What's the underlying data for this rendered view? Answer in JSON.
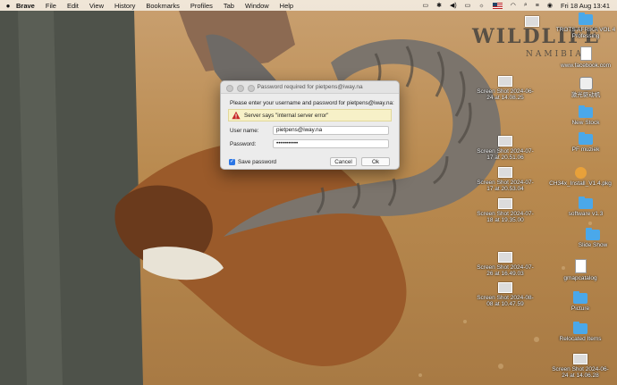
{
  "menubar": {
    "apple_icon": "apple-logo-icon",
    "items": [
      "Brave",
      "File",
      "Edit",
      "View",
      "History",
      "Bookmarks",
      "Profiles",
      "Tab",
      "Window",
      "Help"
    ],
    "clock": "Fri 18 Aug  13:41"
  },
  "wallpaper": {
    "brand_top": "WILDLIFE",
    "brand_bottom": "NAMIBIA"
  },
  "dialog": {
    "title": "Password required for pietpens@iway.na",
    "prompt": "Please enter your username and password for pietpens@iway.na:",
    "warning": "Server says \"internal server error\"",
    "username_label": "User name:",
    "username_value": "pietpens@iway.na",
    "password_label": "Password:",
    "password_value": "•••••••••••",
    "save_label": "Save password",
    "save_checked": true,
    "cancel_label": "Cancel",
    "ok_label": "Ok"
  },
  "desktop_icons": [
    {
      "label": "Screen Shot 2024-06-24 at 14.08.25",
      "kind": "screenshot"
    },
    {
      "label": "New Stock",
      "kind": "folder"
    },
    {
      "label": "Screen Shot 2024-07-17 at 20.51.06",
      "kind": "screenshot"
    },
    {
      "label": "PF muziek",
      "kind": "folder"
    },
    {
      "label": "Screen Shot 2024-07-17 at 20.53.04",
      "kind": "screenshot"
    },
    {
      "label": "CH34x_Install_V1.4.pkg",
      "kind": "package"
    },
    {
      "label": "Screen Shot 2024-07-18 at 19.35.00",
      "kind": "screenshot"
    },
    {
      "label": "software v1.3",
      "kind": "folder"
    },
    {
      "label": "Slide Show",
      "kind": "folder"
    },
    {
      "label": "Screen Shot 2024-07-26 at 16.49.03",
      "kind": "screenshot"
    },
    {
      "label": "gmapcatalog",
      "kind": "document"
    },
    {
      "label": "Screen Shot 2024-08-08 at 10.47.59",
      "kind": "screenshot"
    },
    {
      "label": "Picture",
      "kind": "folder"
    },
    {
      "label": "Relocated Items",
      "kind": "folder"
    },
    {
      "label": "Screen Shot 2024-06-24 at 14.06.28",
      "kind": "screenshot"
    },
    {
      "label": "TROTS AFRIKA VOL 4 Professing",
      "kind": "folder"
    },
    {
      "label": "www.facebook.com",
      "kind": "document"
    },
    {
      "label": "激光驱动机",
      "kind": "app"
    }
  ]
}
